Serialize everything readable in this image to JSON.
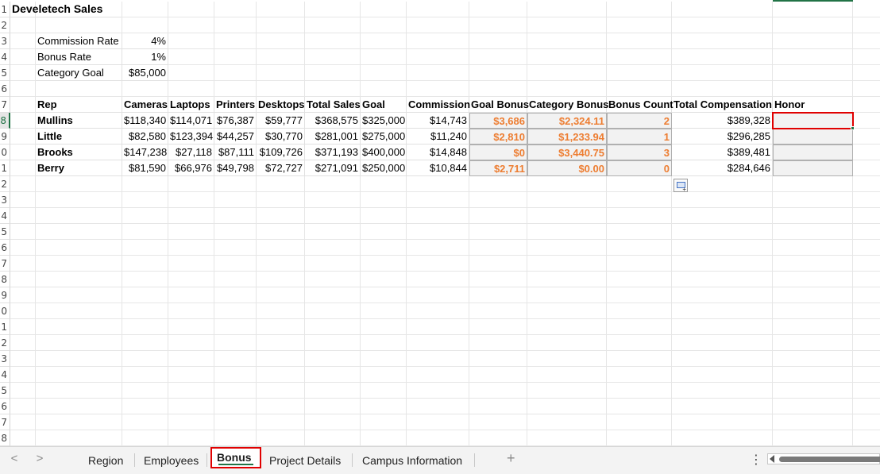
{
  "row_numbers": [
    "1",
    "2",
    "3",
    "4",
    "5",
    "6",
    "7",
    "8",
    "9",
    "0",
    "1",
    "2",
    "3",
    "4",
    "5",
    "6",
    "7",
    "8",
    "9",
    "0",
    "1",
    "2",
    "3",
    "4",
    "5",
    "6",
    "7",
    "8"
  ],
  "title": "Develetech Sales",
  "params": [
    {
      "label": "Commission Rate",
      "value": "4%"
    },
    {
      "label": "Bonus Rate",
      "value": "1%"
    },
    {
      "label": "Category Goal",
      "value": "$85,000"
    }
  ],
  "headers": [
    "Rep",
    "Cameras",
    "Laptops",
    "Printers",
    "Desktops",
    "Total Sales",
    "Goal",
    "Commission",
    "Goal Bonus",
    "Category Bonus",
    "Bonus Count",
    "Total Compensation",
    "Honor"
  ],
  "rows": [
    {
      "rep": "Mullins",
      "cameras": "$118,340",
      "laptops": "$114,071",
      "printers": "$76,387",
      "desktops": "$59,777",
      "total_sales": "$368,575",
      "goal": "$325,000",
      "commission": "$14,743",
      "goal_bonus": "$3,686",
      "category_bonus": "$2,324.11",
      "bonus_count": "2",
      "total_comp": "$389,328",
      "honor": ""
    },
    {
      "rep": "Little",
      "cameras": "$82,580",
      "laptops": "$123,394",
      "printers": "$44,257",
      "desktops": "$30,770",
      "total_sales": "$281,001",
      "goal": "$275,000",
      "commission": "$11,240",
      "goal_bonus": "$2,810",
      "category_bonus": "$1,233.94",
      "bonus_count": "1",
      "total_comp": "$296,285",
      "honor": ""
    },
    {
      "rep": "Brooks",
      "cameras": "$147,238",
      "laptops": "$27,118",
      "printers": "$87,111",
      "desktops": "$109,726",
      "total_sales": "$371,193",
      "goal": "$400,000",
      "commission": "$14,848",
      "goal_bonus": "$0",
      "category_bonus": "$3,440.75",
      "bonus_count": "3",
      "total_comp": "$389,481",
      "honor": ""
    },
    {
      "rep": "Berry",
      "cameras": "$81,590",
      "laptops": "$66,976",
      "printers": "$49,798",
      "desktops": "$72,727",
      "total_sales": "$271,091",
      "goal": "$250,000",
      "commission": "$10,844",
      "goal_bonus": "$2,711",
      "category_bonus": "$0.00",
      "bonus_count": "0",
      "total_comp": "$284,646",
      "honor": ""
    }
  ],
  "tabs": [
    "Region",
    "Employees",
    "Bonus",
    "Project Details",
    "Campus Information"
  ],
  "active_tab": "Bonus",
  "nav": {
    "prev": "<",
    "next": ">",
    "add": "+",
    "more": "⋮"
  },
  "colors": {
    "accent": "#217346",
    "highlight": "#e00000",
    "bonus_text": "#ed7d31",
    "shade": "#f2f2f2"
  }
}
